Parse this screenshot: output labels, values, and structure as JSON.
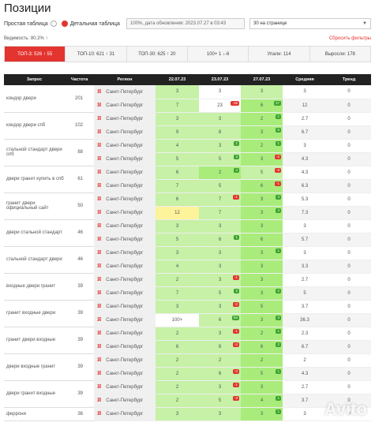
{
  "page_title": "Позиции",
  "view": {
    "simple": "Простая таблица",
    "detailed": "Детальная таблица"
  },
  "update_info": "100%, дата обновления: 2023.07.27 в 03:43",
  "per_page": "30 на странице",
  "visibility": "Видимость: 80.2% ↑",
  "reset_filters": "Сбросить фильтры",
  "tabs": [
    "ТОП-3: 526 ↑ 55",
    "ТОП-10: 621 ↑ 31",
    "ТОП-30: 625 ↑ 20",
    "100+ 1 ↓-6",
    "Упали: 114",
    "Выросли: 178"
  ],
  "columns": [
    "Запрос",
    "Частота",
    "Регион",
    "22.07.23",
    "23.07.23",
    "27.07.23",
    "Средняя",
    "Тренд"
  ],
  "region_label": "Санкт-Петербург",
  "ya_glyph": "Я",
  "groups": [
    {
      "q": "кондор двери",
      "f": "201",
      "rows": [
        [
          "3",
          "3",
          "3",
          "3",
          "0"
        ],
        [
          "7",
          "23",
          "6",
          "12",
          "0"
        ]
      ]
    },
    {
      "q": "кондор двери спб",
      "f": "102",
      "rows": [
        [
          "3",
          "3",
          "2",
          "2.7",
          "0"
        ],
        [
          "9",
          "8",
          "3",
          "6.7",
          "0"
        ]
      ]
    },
    {
      "q": "стальной стандарт двери спб",
      "f": "88",
      "rows": [
        [
          "4",
          "3",
          "2",
          "3",
          "0"
        ],
        [
          "5",
          "5",
          "3",
          "4.3",
          "0"
        ]
      ]
    },
    {
      "q": "двери гранит купить в спб",
      "f": "61",
      "rows": [
        [
          "6",
          "2",
          "5",
          "4.3",
          "0"
        ],
        [
          "7",
          "5",
          "6",
          "6.3",
          "0"
        ]
      ]
    },
    {
      "q": "гранит двери официальный сайт",
      "f": "50",
      "rows": [
        [
          "6",
          "7",
          "3",
          "5.3",
          "0"
        ],
        [
          "12",
          "7",
          "3",
          "7.3",
          "0"
        ]
      ]
    },
    {
      "q": "двери стальной стандарт",
      "f": "46",
      "rows": [
        [
          "3",
          "3",
          "3",
          "3",
          "0"
        ],
        [
          "5",
          "6",
          "6",
          "5.7",
          "0"
        ]
      ]
    },
    {
      "q": "стальной стандарт двери",
      "f": "46",
      "rows": [
        [
          "3",
          "3",
          "3",
          "3",
          "0"
        ],
        [
          "4",
          "3",
          "3",
          "3.3",
          "0"
        ]
      ]
    },
    {
      "q": "входные двери гранит",
      "f": "39",
      "rows": [
        [
          "2",
          "3",
          "3",
          "2.7",
          "0"
        ],
        [
          "7",
          "5",
          "3",
          "5",
          "0"
        ]
      ]
    },
    {
      "q": "гранит входные двери",
      "f": "39",
      "rows": [
        [
          "3",
          "3",
          "5",
          "3.7",
          "0"
        ],
        [
          "100+",
          "6",
          "3",
          "36.3",
          "0"
        ]
      ]
    },
    {
      "q": "гранит двери входные",
      "f": "39",
      "rows": [
        [
          "2",
          "3",
          "2",
          "2.3",
          "0"
        ],
        [
          "6",
          "8",
          "6",
          "6.7",
          "0"
        ]
      ]
    },
    {
      "q": "двери входные гранит",
      "f": "39",
      "rows": [
        [
          "2",
          "2",
          "2",
          "2",
          "0"
        ],
        [
          "2",
          "6",
          "5",
          "4.3",
          "0"
        ]
      ]
    },
    {
      "q": "двери гранит входные",
      "f": "39",
      "rows": [
        [
          "2",
          "3",
          "3",
          "2.7",
          "0"
        ],
        [
          "2",
          "5",
          "4",
          "3.7",
          "0"
        ]
      ]
    },
    {
      "q": "феррони",
      "f": "36",
      "rows": [
        [
          "3",
          "3",
          "3",
          "3",
          "0"
        ]
      ]
    }
  ],
  "watermark": "Avito"
}
